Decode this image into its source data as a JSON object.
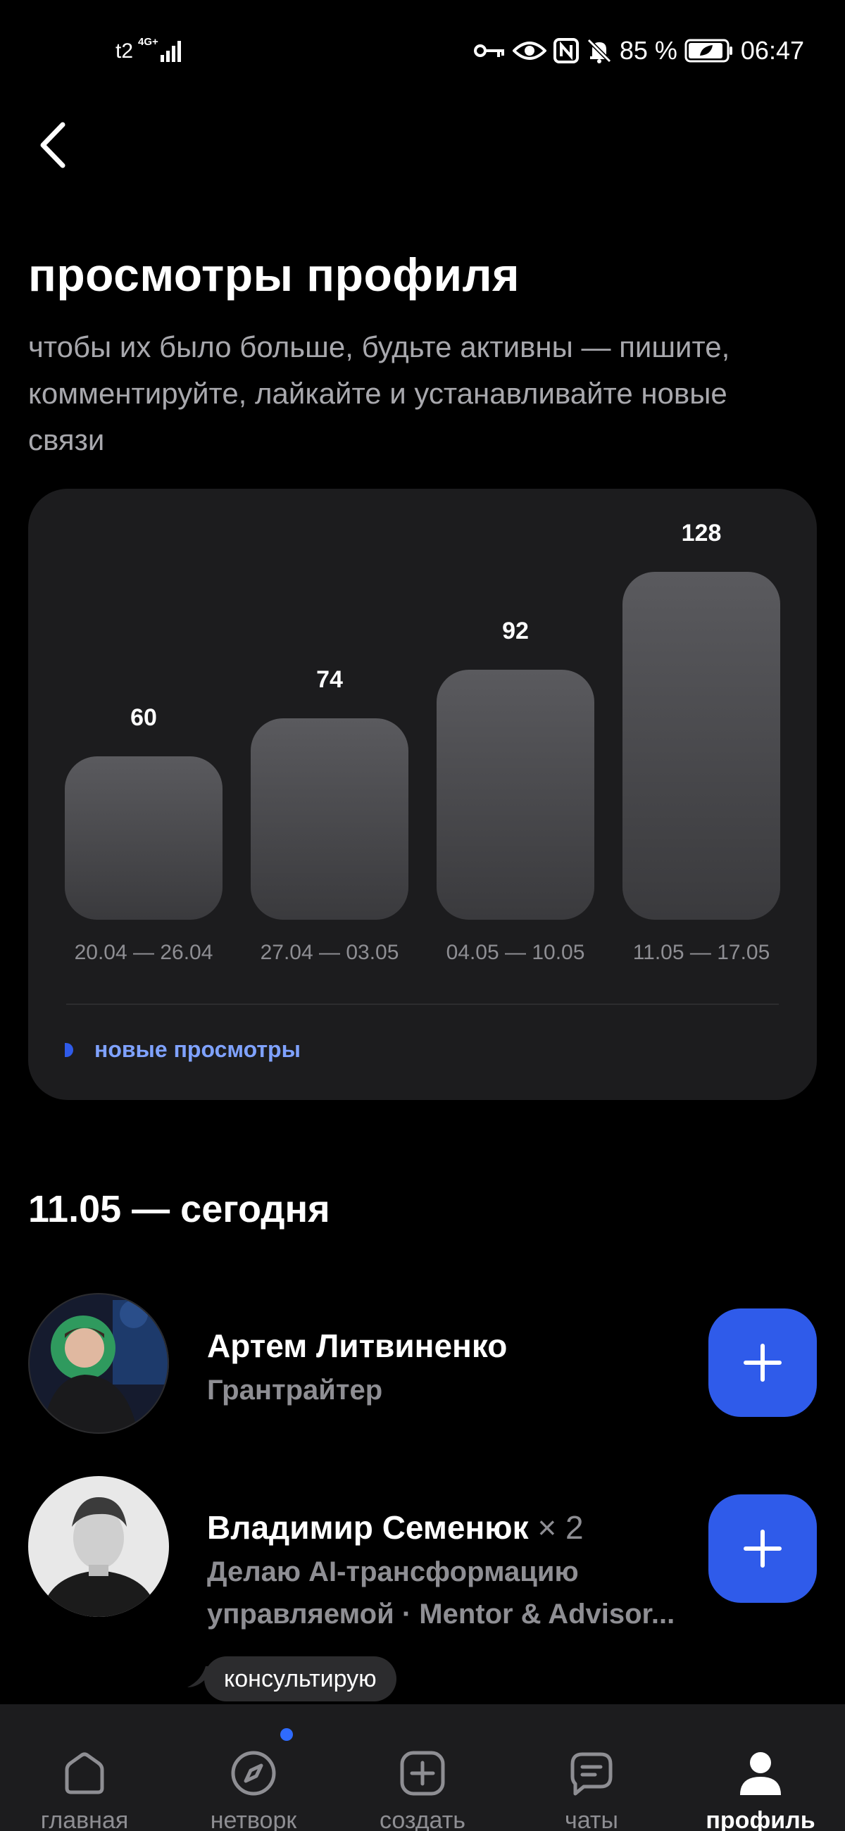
{
  "status_bar": {
    "carrier": "t2",
    "network": "4G+",
    "battery": "85 %",
    "time": "06:47",
    "icons": [
      "key-icon",
      "eye-icon",
      "nfc-icon",
      "bell-muted-icon",
      "battery-icon"
    ]
  },
  "header": {
    "back_icon": "chevron-left-icon"
  },
  "page": {
    "title": "просмотры профиля",
    "subtitle": "чтобы их было больше, будьте активны — пишите, комментируйте, лайкайте и устанавливайте новые связи"
  },
  "chart_data": {
    "type": "bar",
    "categories": [
      "20.04 — 26.04",
      "27.04 — 03.05",
      "04.05 — 10.05",
      "11.05 — 17.05"
    ],
    "series": [
      {
        "name": "новые просмотры",
        "values": [
          60,
          74,
          92,
          128
        ]
      }
    ],
    "value_labels": [
      "60",
      "74",
      "92",
      "128"
    ],
    "legend": {
      "label": "новые просмотры",
      "position": "bottom-left",
      "color": "#2f5bea"
    },
    "grid": false
  },
  "section": {
    "title": "11.05 — сегодня"
  },
  "people": [
    {
      "name": "Артем Литвиненко",
      "multiplier": "",
      "description": "Грантрайтер"
    },
    {
      "name": "Владимир Семенюк",
      "multiplier": "× 2",
      "description": "Делаю AI-трансформацию управляемой · Mentor & Advisor..."
    }
  ],
  "tooltip": {
    "text": "консультирую"
  },
  "tabs": [
    {
      "label": "главная",
      "icon": "home-icon"
    },
    {
      "label": "нетворк",
      "icon": "compass-icon",
      "has_badge": true
    },
    {
      "label": "создать",
      "icon": "plus-square-icon"
    },
    {
      "label": "чаты",
      "icon": "chat-icon"
    },
    {
      "label": "профиль",
      "icon": "user-icon",
      "active": true
    }
  ],
  "colors": {
    "accent": "#2f5bea",
    "legend_text": "#7fa2ff",
    "card": "#1c1c1e",
    "background": "#000000"
  }
}
